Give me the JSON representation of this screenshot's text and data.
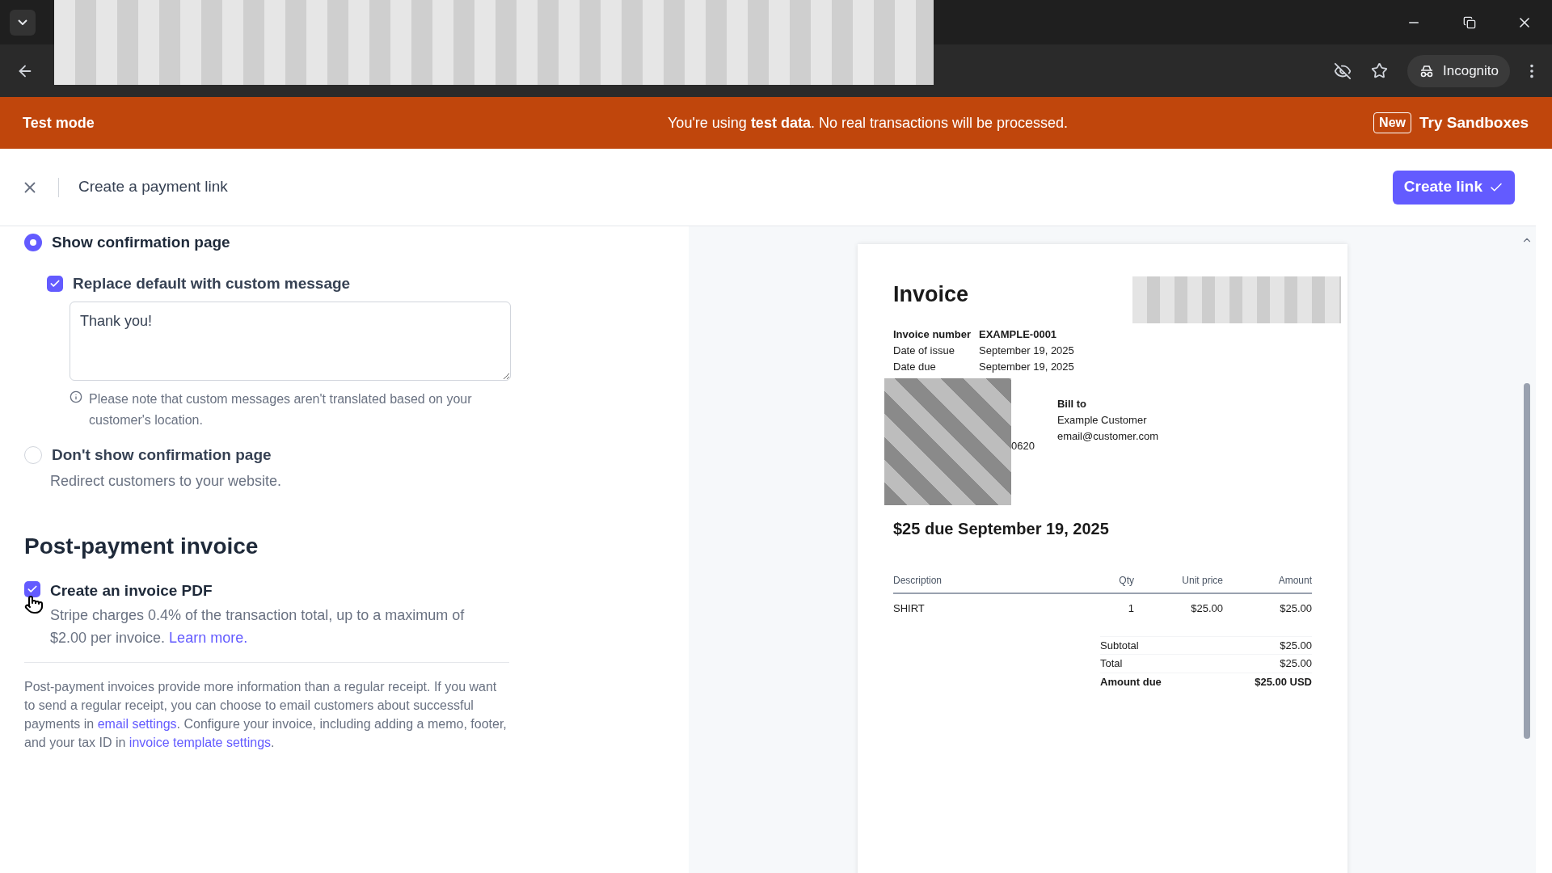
{
  "browser": {
    "profile": "Incognito"
  },
  "banner": {
    "label": "Test mode",
    "message": "You're using **test data**. No real transactions will be processed.",
    "badge": "New",
    "link": "Try Sandboxes"
  },
  "header": {
    "title": "Create a payment link",
    "primary_button": "Create link"
  },
  "confirmation_options": [
    {
      "label": "Show confirmation page",
      "selected": true,
      "custom_message": {
        "label": "Replace default with custom message",
        "checked": true,
        "value": "Thank you!",
        "note": "Please note that custom messages aren't translated based on your customer's location."
      }
    },
    {
      "label": "Don't show confirmation page",
      "selected": false,
      "description": "Redirect customers to your website."
    }
  ],
  "post_payment": {
    "heading": "Post-payment invoice",
    "option": {
      "label": "Create an invoice PDF",
      "checked": true,
      "description": "Stripe charges 0.4% of the transaction total, up to a maximum of $2.00 per invoice.",
      "link": "Learn more."
    },
    "footnote": [
      {
        "kind": "text",
        "text": "Post-payment invoices provide more information than a regular receipt. If you want to send a regular receipt, you can choose to email customers about successful payments in"
      },
      {
        "kind": "link",
        "text": "email settings"
      },
      {
        "kind": "text",
        "text": ". Configure your invoice, including adding a memo, footer, and your tax ID in"
      },
      {
        "kind": "link",
        "text": "invoice template settings"
      },
      {
        "kind": "text",
        "text": "."
      }
    ]
  },
  "invoice": {
    "title": "Invoice",
    "meta": [
      {
        "label": "Invoice number",
        "value": "EXAMPLE-0001",
        "strong": true
      },
      {
        "label": "Date of issue",
        "value": "September 19, 2025",
        "strong": false
      },
      {
        "label": "Date due",
        "value": "September 19, 2025",
        "strong": false
      }
    ],
    "partial_text": "0620",
    "bill_to": {
      "heading": "Bill to",
      "lines": [
        "Example Customer",
        "email@customer.com"
      ]
    },
    "due_line": "$25 due September 19, 2025",
    "columns": [
      "Description",
      "Qty",
      "Unit price",
      "Amount"
    ],
    "rows": [
      [
        "SHIRT",
        "1",
        "$25.00",
        "$25.00"
      ]
    ],
    "totals": [
      {
        "label": "Subtotal",
        "value": "$25.00",
        "strong": false
      },
      {
        "label": "Total",
        "value": "$25.00",
        "strong": false
      },
      {
        "label": "Amount due",
        "value": "$25.00 USD",
        "strong": true
      }
    ]
  }
}
